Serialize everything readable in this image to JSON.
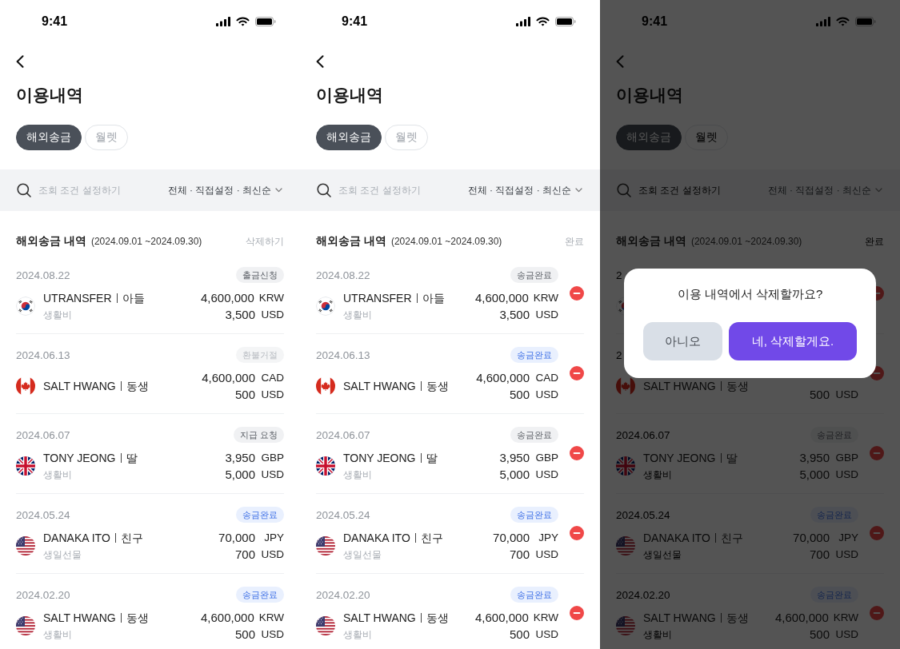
{
  "screens": [
    {
      "status_bar": {
        "time": "9:41"
      },
      "title": "이용내역",
      "tabs": [
        {
          "label": "해외송금",
          "selected": true
        },
        {
          "label": "월렛",
          "selected": false
        }
      ],
      "filter_bar": {
        "placeholder": "조회 조건 설정하기",
        "summary": "전체 · 직접설정 · 최신순"
      },
      "section": {
        "title": "해외송금 내역",
        "period": "(2024.09.01 ~2024.09.30)",
        "action": "삭제하기"
      },
      "editing": false,
      "transfers": [
        {
          "date": "2024.08.22",
          "status": {
            "label": "출금신청",
            "kind": "neutral"
          },
          "flag": {
            "kind": "korea"
          },
          "recipient": "UTRANSFER",
          "relation": "아들",
          "memo": "생활비",
          "amount": {
            "value": "4,600,000",
            "currency": "KRW"
          },
          "converted": {
            "value": "3,500",
            "currency": "USD"
          }
        },
        {
          "date": "2024.06.13",
          "status": {
            "label": "환불거절",
            "kind": "muted"
          },
          "flag": {
            "kind": "canada"
          },
          "recipient": "SALT HWANG",
          "relation": "동생",
          "amount": {
            "value": "4,600,000",
            "currency": "CAD"
          },
          "converted": {
            "value": "500",
            "currency": "USD"
          }
        },
        {
          "date": "2024.06.07",
          "status": {
            "label": "지급 요청",
            "kind": "neutral"
          },
          "flag": {
            "kind": "uk"
          },
          "recipient": "TONY JEONG",
          "relation": "딸",
          "memo": "생활비",
          "amount": {
            "value": "3,950",
            "currency": "GBP"
          },
          "converted": {
            "value": "5,000",
            "currency": "USD"
          }
        },
        {
          "date": "2024.05.24",
          "status": {
            "label": "송금완료",
            "kind": "accent"
          },
          "flag": {
            "kind": "usa"
          },
          "recipient": "DANAKA ITO",
          "relation": "친구",
          "memo": "생일선물",
          "amount": {
            "value": "70,000",
            "currency": "JPY"
          },
          "converted": {
            "value": "700",
            "currency": "USD"
          }
        },
        {
          "date": "2024.02.20",
          "status": {
            "label": "송금완료",
            "kind": "accent"
          },
          "flag": {
            "kind": "usa"
          },
          "recipient": "SALT HWANG",
          "relation": "동생",
          "memo": "생활비",
          "amount": {
            "value": "4,600,000",
            "currency": "KRW"
          },
          "converted": {
            "value": "500",
            "currency": "USD"
          }
        }
      ]
    },
    {
      "status_bar": {
        "time": "9:41"
      },
      "title": "이용내역",
      "tabs": [
        {
          "label": "해외송금",
          "selected": true
        },
        {
          "label": "월렛",
          "selected": false
        }
      ],
      "filter_bar": {
        "placeholder": "조회 조건 설정하기",
        "summary": "전체 · 직접설정 · 최신순"
      },
      "section": {
        "title": "해외송금 내역",
        "period": "(2024.09.01 ~2024.09.30)",
        "action": "완료"
      },
      "editing": true,
      "transfers": [
        {
          "date": "2024.08.22",
          "status": {
            "label": "송금완료",
            "kind": "neutral"
          },
          "flag": {
            "kind": "korea"
          },
          "recipient": "UTRANSFER",
          "relation": "아들",
          "memo": "생활비",
          "amount": {
            "value": "4,600,000",
            "currency": "KRW"
          },
          "converted": {
            "value": "3,500",
            "currency": "USD"
          }
        },
        {
          "date": "2024.06.13",
          "status": {
            "label": "송금완료",
            "kind": "accent"
          },
          "flag": {
            "kind": "canada"
          },
          "recipient": "SALT HWANG",
          "relation": "동생",
          "amount": {
            "value": "4,600,000",
            "currency": "CAD"
          },
          "converted": {
            "value": "500",
            "currency": "USD"
          }
        },
        {
          "date": "2024.06.07",
          "status": {
            "label": "송금완료",
            "kind": "neutral"
          },
          "flag": {
            "kind": "uk"
          },
          "recipient": "TONY JEONG",
          "relation": "딸",
          "memo": "생활비",
          "amount": {
            "value": "3,950",
            "currency": "GBP"
          },
          "converted": {
            "value": "5,000",
            "currency": "USD"
          }
        },
        {
          "date": "2024.05.24",
          "status": {
            "label": "송금완료",
            "kind": "accent"
          },
          "flag": {
            "kind": "usa"
          },
          "recipient": "DANAKA ITO",
          "relation": "친구",
          "memo": "생일선물",
          "amount": {
            "value": "70,000",
            "currency": "JPY"
          },
          "converted": {
            "value": "700",
            "currency": "USD"
          }
        },
        {
          "date": "2024.02.20",
          "status": {
            "label": "송금완료",
            "kind": "accent"
          },
          "flag": {
            "kind": "usa"
          },
          "recipient": "SALT HWANG",
          "relation": "동생",
          "memo": "생활비",
          "amount": {
            "value": "4,600,000",
            "currency": "KRW"
          },
          "converted": {
            "value": "500",
            "currency": "USD"
          }
        }
      ]
    },
    {
      "status_bar": {
        "time": "9:41"
      },
      "title": "이용내역",
      "tabs": [
        {
          "label": "해외송금",
          "selected": true
        },
        {
          "label": "월렛",
          "selected": false
        }
      ],
      "filter_bar": {
        "placeholder": "조회 조건 설정하기",
        "summary": "전체 · 직접설정 · 최신순"
      },
      "section": {
        "title": "해외송금 내역",
        "period": "(2024.09.01 ~2024.09.30)",
        "action": "완료"
      },
      "editing": true,
      "transfers": [
        {
          "date": "2",
          "flag": {
            "kind": "korea"
          }
        },
        {
          "date": "2",
          "flag": {
            "kind": "canada"
          },
          "recipient": "SALT HWANG",
          "relation": "동생",
          "converted": {
            "value": "500",
            "currency": "USD"
          }
        },
        {
          "date": "2024.06.07",
          "status": {
            "label": "송금완료",
            "kind": "neutral"
          },
          "flag": {
            "kind": "uk"
          },
          "recipient": "TONY JEONG",
          "relation": "딸",
          "memo": "생활비",
          "amount": {
            "value": "3,950",
            "currency": "GBP"
          },
          "converted": {
            "value": "5,000",
            "currency": "USD"
          }
        },
        {
          "date": "2024.05.24",
          "status": {
            "label": "송금완료",
            "kind": "accent"
          },
          "flag": {
            "kind": "usa"
          },
          "recipient": "DANAKA ITO",
          "relation": "친구",
          "memo": "생일선물",
          "amount": {
            "value": "70,000",
            "currency": "JPY"
          },
          "converted": {
            "value": "700",
            "currency": "USD"
          }
        },
        {
          "date": "2024.02.20",
          "status": {
            "label": "송금완료",
            "kind": "accent"
          },
          "flag": {
            "kind": "usa"
          },
          "recipient": "SALT HWANG",
          "relation": "동생",
          "memo": "생활비",
          "amount": {
            "value": "4,600,000",
            "currency": "KRW"
          },
          "converted": {
            "value": "500",
            "currency": "USD"
          }
        }
      ],
      "dialog": {
        "message": "이용 내역에서 삭제할까요?",
        "buttons": [
          {
            "label": "아니오",
            "kind": "secondary"
          },
          {
            "label": "네, 삭제할게요.",
            "kind": "primary"
          }
        ]
      }
    }
  ]
}
